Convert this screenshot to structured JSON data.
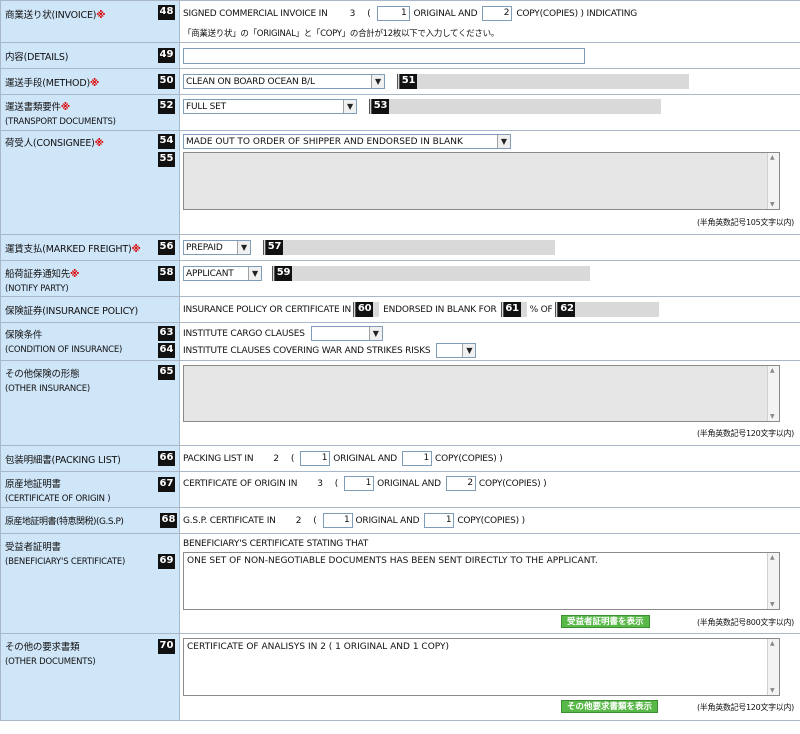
{
  "rows": {
    "invoice": {
      "label": "商業送り状(INVOICE)",
      "req": "※",
      "num": "48",
      "text1": "SIGNED COMMERCIAL INVOICE IN",
      "count": "3",
      "paren": "(",
      "original_value": "1",
      "original_label": "ORIGINAL AND",
      "copy_value": "2",
      "copy_label": "COPY(COPIES) ) INDICATING",
      "hint": "「商業送り状」の「ORIGINAL」と「COPY」の合計が12枚以下で入力してください。"
    },
    "details": {
      "label": "内容(DETAILS)",
      "num": "49",
      "value": ""
    },
    "method": {
      "label": "運送手段(METHOD)",
      "req": "※",
      "num": "50",
      "select": "CLEAN ON BOARD OCEAN B/L",
      "num2": "51"
    },
    "transport": {
      "label": "運送書類要件",
      "req": "※",
      "sub": "(TRANSPORT DOCUMENTS)",
      "num": "52",
      "select": "FULL SET",
      "num2": "53"
    },
    "consignee": {
      "label": "荷受人(CONSIGNEE)",
      "req": "※",
      "num": "54",
      "num2": "55",
      "select": "MADE OUT TO ORDER OF SHIPPER AND ENDORSED IN BLANK",
      "textarea": "",
      "note": "(半角英数記号105文字以内)"
    },
    "freight": {
      "label": "運賃支払(MARKED FREIGHT)",
      "req": "※",
      "num": "56",
      "select": "PREPAID",
      "num2": "57"
    },
    "notify": {
      "label": "船荷証券通知先",
      "req": "※",
      "sub": "(NOTIFY PARTY)",
      "num": "58",
      "select": "APPLICANT",
      "num2": "59"
    },
    "insurance": {
      "label": "保険証券(INSURANCE POLICY)",
      "text1": "INSURANCE POLICY OR CERTIFICATE IN",
      "num": "60",
      "text2": "ENDORSED IN BLANK FOR",
      "num2": "61",
      "text3": "% OF",
      "num3": "62"
    },
    "condition": {
      "label": "保険条件",
      "sub": "(CONDITION OF INSURANCE)",
      "num": "63",
      "num2": "64",
      "line1": "INSTITUTE CARGO CLAUSES",
      "line2": "INSTITUTE CLAUSES COVERING WAR AND STRIKES RISKS",
      "select1": "",
      "select2": ""
    },
    "other_ins": {
      "label": "その他保険の形態",
      "sub": "(OTHER INSURANCE)",
      "num": "65",
      "textarea": "",
      "note": "(半角英数記号120文字以内)"
    },
    "packing": {
      "label": "包装明細書(PACKING LIST)",
      "num": "66",
      "text1": "PACKING LIST IN",
      "count": "2",
      "paren": "(",
      "original_value": "1",
      "original_label": "ORIGINAL AND",
      "copy_value": "1",
      "copy_label": "COPY(COPIES) )"
    },
    "origin": {
      "label": "原産地証明書",
      "sub": "(CERTIFICATE OF ORIGIN )",
      "num": "67",
      "text1": "CERTIFICATE OF ORIGIN IN",
      "count": "3",
      "paren": "(",
      "original_value": "1",
      "original_label": "ORIGINAL AND",
      "copy_value": "2",
      "copy_label": "COPY(COPIES) )"
    },
    "gsp": {
      "label": "原産地証明書(特恵関税)(G.S.P)",
      "num": "68",
      "text1": "G.S.P. CERTIFICATE IN",
      "count": "2",
      "paren": "(",
      "original_value": "1",
      "original_label": "ORIGINAL AND",
      "copy_value": "1",
      "copy_label": "COPY(COPIES) )"
    },
    "beneficiary": {
      "label": "受益者証明書",
      "sub": "(BENEFICIARY'S CERTIFICATE)",
      "num": "69",
      "intro": "BENEFICIARY'S CERTIFICATE STATING THAT",
      "textarea": "ONE SET OF NON-NEGOTIABLE DOCUMENTS HAS BEEN SENT DIRECTLY TO THE APPLICANT.",
      "button": "受益者証明書を表示",
      "note": "(半角英数記号800文字以内)"
    },
    "other_docs": {
      "label": "その他の要求書類",
      "sub": "(OTHER DOCUMENTS)",
      "num": "70",
      "textarea": "CERTIFICATE OF ANALISYS IN 2 ( 1 ORIGINAL AND 1 COPY)",
      "button": "その他要求書類を表示",
      "note": "(半角英数記号120文字以内)"
    }
  },
  "colors": {
    "label_bg": "#cfe5f8",
    "required": "#dd0000",
    "button": "#58b848"
  }
}
